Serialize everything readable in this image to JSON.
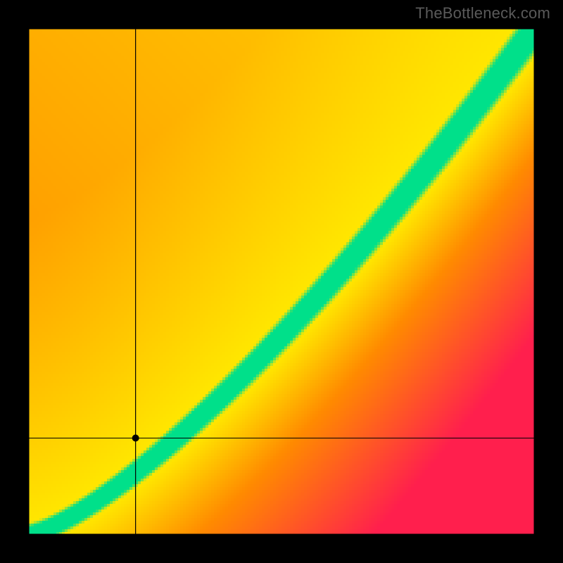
{
  "watermark": "TheBottleneck.com",
  "chart_data": {
    "type": "heatmap",
    "title": "",
    "xlabel": "",
    "ylabel": "",
    "xlim": [
      0,
      1
    ],
    "ylim": [
      0,
      1
    ],
    "crosshair": {
      "x": 0.212,
      "y": 0.191
    },
    "point": {
      "x": 0.212,
      "y": 0.191
    },
    "ridge": {
      "description": "green optimal band running diagonally; centerline y≈x^1.35, band half-width ≈0.04",
      "exponent": 1.35,
      "half_width": 0.04
    },
    "gradient_stops": {
      "far_negative": "#ff1f4d",
      "mid_negative": "#ff8a00",
      "near": "#ffe600",
      "on_ridge": "#00e08a",
      "far_positive_corner": "#ffe14a"
    },
    "grid": false,
    "legend": false,
    "pixelated": true,
    "resolution": 180
  }
}
